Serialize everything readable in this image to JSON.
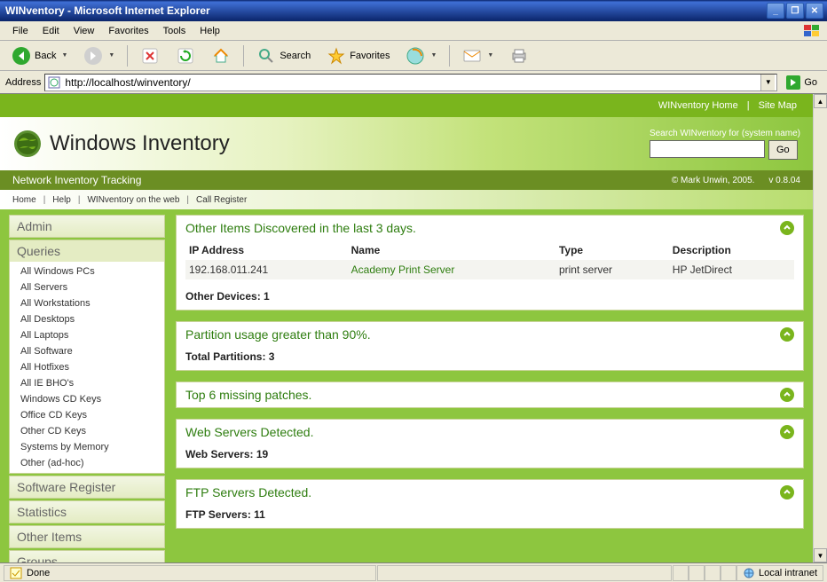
{
  "window": {
    "title": "WINventory - Microsoft Internet Explorer"
  },
  "menubar": {
    "file": "File",
    "edit": "Edit",
    "view": "View",
    "favorites": "Favorites",
    "tools": "Tools",
    "help": "Help"
  },
  "toolbar": {
    "back": "Back",
    "search": "Search",
    "favorites": "Favorites"
  },
  "addressbar": {
    "label": "Address",
    "url": "http://localhost/winventory/",
    "go": "Go"
  },
  "topnav": {
    "home": "WINventory Home",
    "sitemap": "Site Map"
  },
  "brand": {
    "title": "Windows Inventory"
  },
  "search": {
    "label": "Search WINventory for (system name)",
    "go": "Go",
    "value": ""
  },
  "greenbar": {
    "subtitle": "Network Inventory Tracking",
    "copyright": "© Mark Unwin, 2005.",
    "version": "v 0.8.04"
  },
  "subnav": {
    "home": "Home",
    "help": "Help",
    "web": "WINventory on the web",
    "call": "Call Register"
  },
  "sidebar": {
    "admin": "Admin",
    "queries": "Queries",
    "items": [
      "All Windows PCs",
      "All Servers",
      "All Workstations",
      "All Desktops",
      "All Laptops",
      "All Software",
      "All Hotfixes",
      "All IE BHO's",
      "Windows CD Keys",
      "Office CD Keys",
      "Other CD Keys",
      "Systems by Memory",
      "Other (ad-hoc)"
    ],
    "software_register": "Software Register",
    "statistics": "Statistics",
    "other_items": "Other Items",
    "groups": "Groups"
  },
  "panels": {
    "other_items": {
      "title": "Other Items Discovered in the last 3 days.",
      "cols": {
        "ip": "IP Address",
        "name": "Name",
        "type": "Type",
        "desc": "Description"
      },
      "row": {
        "ip": "192.168.011.241",
        "name": "Academy Print Server",
        "type": "print server",
        "desc": "HP JetDirect"
      },
      "summary_label": "Other Devices: ",
      "summary_value": "1"
    },
    "partitions": {
      "title": "Partition usage greater than 90%.",
      "summary_label": "Total Partitions: ",
      "summary_value": "3"
    },
    "patches": {
      "title": "Top 6 missing patches."
    },
    "web": {
      "title": "Web Servers Detected.",
      "summary_label": "Web Servers: ",
      "summary_value": "19"
    },
    "ftp": {
      "title": "FTP Servers Detected.",
      "summary_label": "FTP Servers: ",
      "summary_value": "11"
    }
  },
  "statusbar": {
    "done": "Done",
    "zone": "Local intranet"
  }
}
